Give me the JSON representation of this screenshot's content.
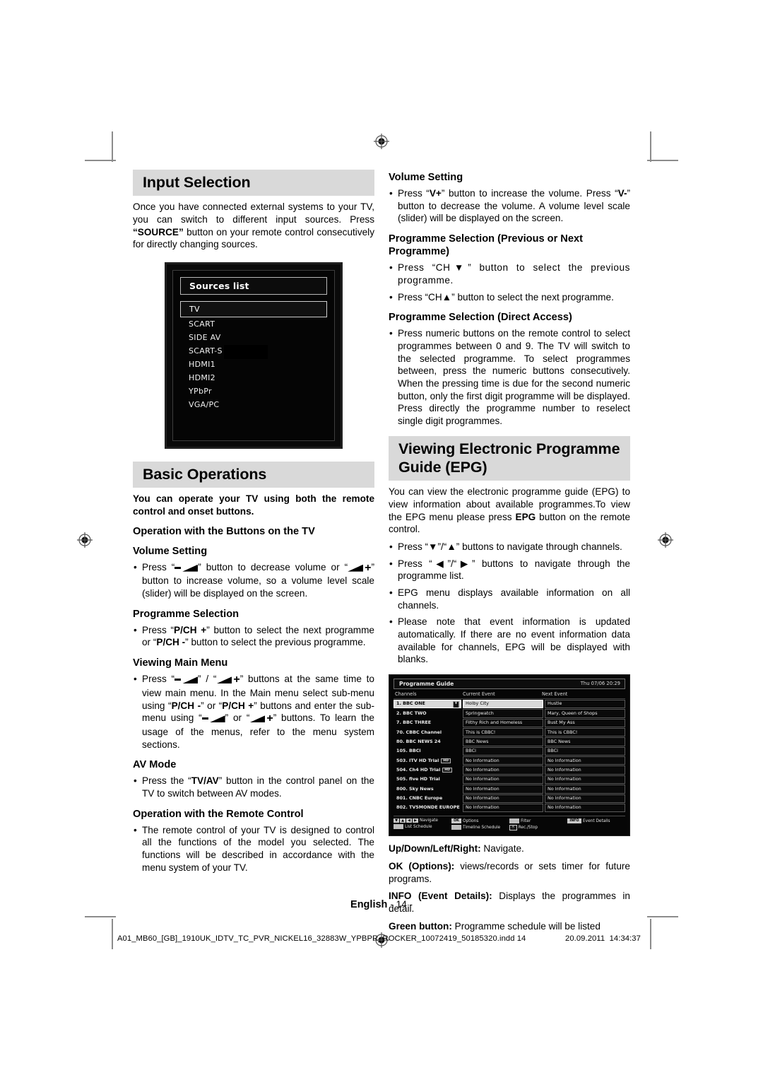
{
  "document": {
    "language_footer": "English",
    "page_label": "- 14 -",
    "print_filename": "A01_MB60_[GB]_1910UK_IDTV_TC_PVR_NICKEL16_32883W_YPBPR_ROCKER_10072419_50185320.indd   14",
    "print_date": "20.09.2011",
    "print_time": "14:34:37"
  },
  "left_column": {
    "input_selection": {
      "heading": "Input Selection",
      "paragraph": "Once you have connected external systems to your TV, you can switch to different input sources. Press “SOURCE” button on your remote control consecutively for directly changing sources.",
      "paragraph_bold_fragment": "“SOURCE”"
    },
    "sources_screenshot": {
      "title": "Sources list",
      "selected_item": "TV",
      "items": [
        "SCART",
        "SIDE AV",
        "SCART-S",
        "HDMI1",
        "HDMI2",
        "YPbPr",
        "VGA/PC"
      ]
    },
    "basic_operations": {
      "heading": "Basic Operations",
      "intro": "You can operate your TV using both the remote control and onset buttons.",
      "buttons_on_tv_heading": "Operation with the Buttons on the TV",
      "volume_setting": {
        "heading": "Volume Setting",
        "bullet_part1": "Press “",
        "bullet_part2": "” button to decrease volume or “",
        "bullet_part3": "” button to increase volume, so a volume level scale (slider) will be displayed on the screen."
      },
      "programme_selection": {
        "heading": "Programme Selection",
        "bullet_part1": "Press “",
        "bullet_bold1": "P/CH +",
        "bullet_part2": "” button to select the next programme or “",
        "bullet_bold2": "P/CH -",
        "bullet_part3": "” button to select the previous programme."
      },
      "viewing_main_menu": {
        "heading": "Viewing Main Menu",
        "t1": "Press “",
        "t2": "” / “",
        "t3": "”  buttons at the same time to view main menu. In the Main menu select sub-menu using “",
        "b1": "P/CH -",
        "t4": "” or “",
        "b2": "P/CH +",
        "t5": "” buttons and enter the sub-menu using “",
        "t6": "” or “",
        "t7": "” buttons. To learn the usage of the menus, refer to the menu system sections."
      },
      "av_mode": {
        "heading": "AV Mode",
        "t1": "Press the “",
        "b1": "TV/AV",
        "t2": "” button in the control panel on the TV to switch between AV modes."
      },
      "remote_control": {
        "heading": "Operation with the Remote Control",
        "bullet": "The remote control of your TV is designed to control all the functions of the model you selected. The functions will be described in accordance with the menu system of your TV."
      }
    }
  },
  "right_column": {
    "volume_setting": {
      "heading": "Volume Setting",
      "t1": "Press “",
      "b1": "V+",
      "t2": "” button to increase the volume. Press “",
      "b2": "V-",
      "t3": "” button to decrease the volume. A volume level scale (slider) will be displayed on the screen."
    },
    "programme_selection_prev_next": {
      "heading": "Programme Selection (Previous or Next Programme)",
      "bullet1": "Press “CH▼” button to select the previous programme.",
      "bullet2": "Press “CH▲” button to select the next programme."
    },
    "programme_selection_direct": {
      "heading": "Programme Selection (Direct Access)",
      "bullet1": "Press numeric buttons on the remote control to select programmes between 0 and 9. The TV will switch to the selected programme. To select programmes between, press the numeric buttons consecutively. When the pressing time is due for the second numeric button, only the first digit programme will be displayed.  Press directly the programme number to reselect single digit programmes."
    },
    "epg": {
      "heading": "Viewing Electronic Programme Guide (EPG)",
      "intro_t1": "You can view the electronic programme guide (EPG) to view information about available programmes.To view the EPG menu please press ",
      "intro_b1": "EPG",
      "intro_t2": " button on the remote control.",
      "bullets": [
        "Press “▼”/“▲” buttons to navigate through channels.",
        "Press “◀”/“▶” buttons to navigate through the programme list.",
        "EPG menu displays available information on all channels.",
        "Please note that event information is updated automatically. If there are no event information data available for channels, EPG will be displayed with blanks."
      ],
      "key_descriptions": [
        {
          "key": "Up/Down/Left/Right:",
          "desc": " Navigate."
        },
        {
          "key": "OK (Options):",
          "desc": " views/records or sets timer for future programs."
        },
        {
          "key": "INFO (Event Details):",
          "desc": " Displays the programmes in detail."
        },
        {
          "key": "Green button:",
          "desc": " Programme schedule will be listed"
        }
      ]
    },
    "epg_screenshot": {
      "title": "Programme Guide",
      "clock": "Thu 07/06 20:29",
      "columns": [
        "Channels",
        "Current Event",
        "Next Event"
      ],
      "rows": [
        {
          "channel": "1. BBC ONE",
          "current": "Holby City",
          "next": "Hustle",
          "selected": true,
          "hd": false
        },
        {
          "channel": "2. BBC TWO",
          "current": "Springwatch",
          "next": "Mary, Queen of Shops",
          "selected": false,
          "hd": false
        },
        {
          "channel": "7. BBC THREE",
          "current": "Filthy Rich and Homeless",
          "next": "Bust My Ass",
          "selected": false,
          "hd": false
        },
        {
          "channel": "70. CBBC Channel",
          "current": "This is CBBC!",
          "next": "This is CBBC!",
          "selected": false,
          "hd": false
        },
        {
          "channel": "80. BBC NEWS 24",
          "current": "BBC News",
          "next": "BBC News",
          "selected": false,
          "hd": false
        },
        {
          "channel": "105. BBCi",
          "current": "BBCi",
          "next": "BBCi",
          "selected": false,
          "hd": false
        },
        {
          "channel": "503. ITV HD Trial",
          "current": "No Information",
          "next": "No Information",
          "selected": false,
          "hd": true
        },
        {
          "channel": "504. Ch4 HD Trial",
          "current": "No Information",
          "next": "No Information",
          "selected": false,
          "hd": true
        },
        {
          "channel": "505. five HD Trial",
          "current": "No Information",
          "next": "No Information",
          "selected": false,
          "hd": false
        },
        {
          "channel": "800. Sky News",
          "current": "No Information",
          "next": "No Information",
          "selected": false,
          "hd": false
        },
        {
          "channel": "801. CNBC Europe",
          "current": "No Information",
          "next": "No Information",
          "selected": false,
          "hd": false
        },
        {
          "channel": "802. TV5MONDE EUROPE",
          "current": "No Information",
          "next": "No Information",
          "selected": false,
          "hd": false
        }
      ],
      "footer": {
        "navigate": "Navigate",
        "list_schedule": "List Schedule",
        "ok_key": "OK",
        "options": "Options",
        "timeline_schedule": "Timeline Schedule",
        "filter": "Filter",
        "rec_key": "⦿",
        "rec_stop": "Rec./Stop",
        "info_key": "INFO",
        "event_details": "Event Details"
      }
    }
  }
}
